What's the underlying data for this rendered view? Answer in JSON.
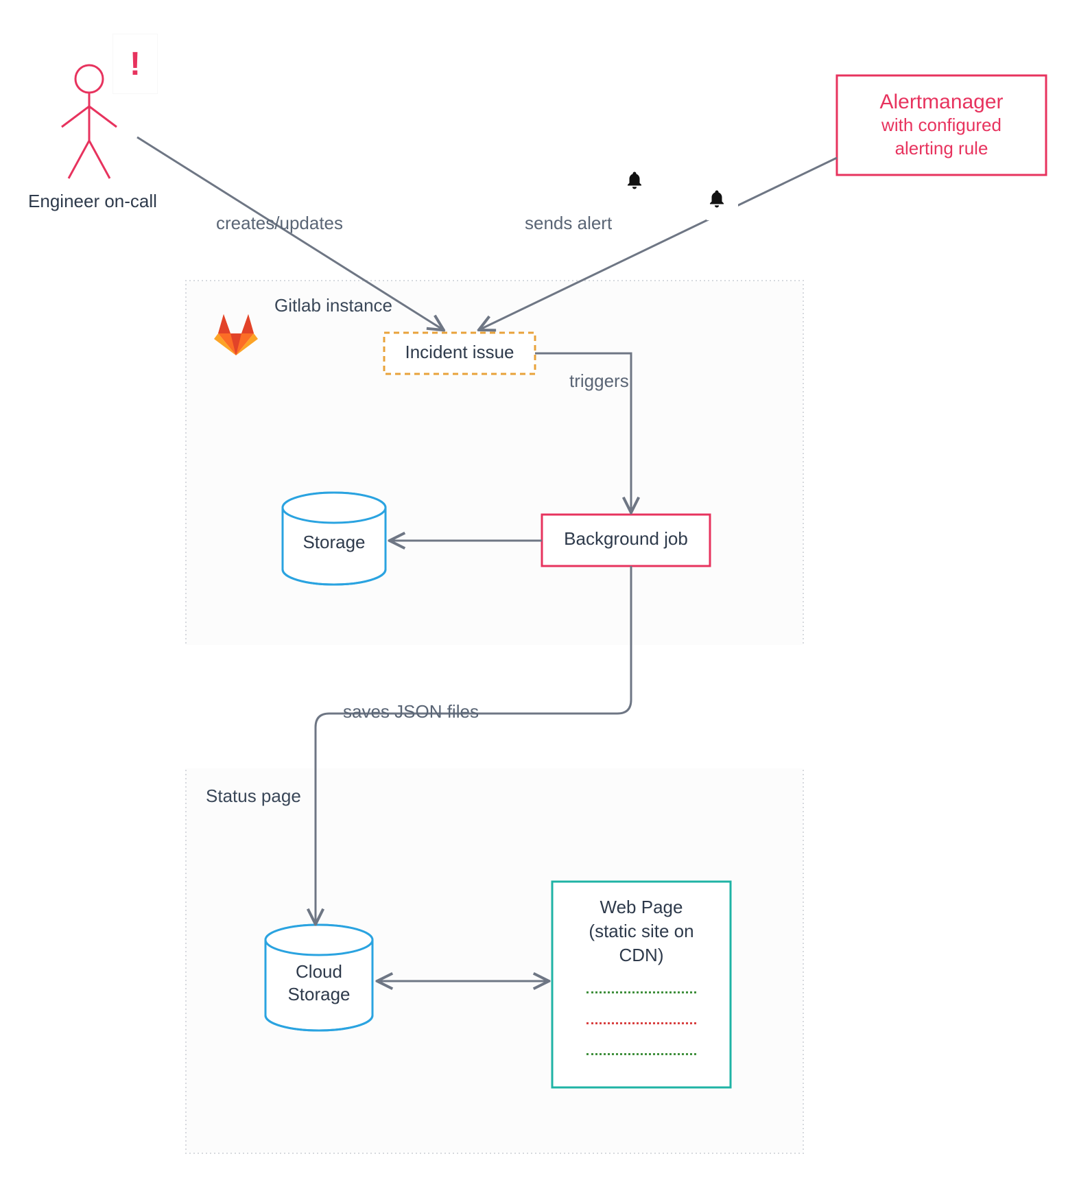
{
  "actors": {
    "engineer_label": "Engineer on-call",
    "exclaim_glyph": "!"
  },
  "alertmanager": {
    "title": "Alertmanager",
    "subtitle_line1": "with configured",
    "subtitle_line2": "alerting rule"
  },
  "containers": {
    "gitlab_instance": "Gitlab instance",
    "status_page": "Status page"
  },
  "nodes": {
    "incident_issue": "Incident issue",
    "background_job": "Background job",
    "storage": "Storage",
    "cloud_storage_l1": "Cloud",
    "cloud_storage_l2": "Storage",
    "webpage_l1": "Web Page",
    "webpage_l2": "(static site on",
    "webpage_l3": "CDN)"
  },
  "edges": {
    "creates_updates": "creates/updates",
    "sends_alert": "sends alert",
    "triggers": "triggers",
    "saves_json": "saves JSON files"
  },
  "colors": {
    "accent_pink": "#e7335e",
    "accent_orange": "#e8a23a",
    "accent_teal": "#1fb3a5",
    "accent_blue": "#2aa3e0",
    "stroke_gray": "#6e7684",
    "text_dark": "#2e3a4b",
    "dot_green": "#3f8f3c",
    "dot_red": "#d84040"
  }
}
